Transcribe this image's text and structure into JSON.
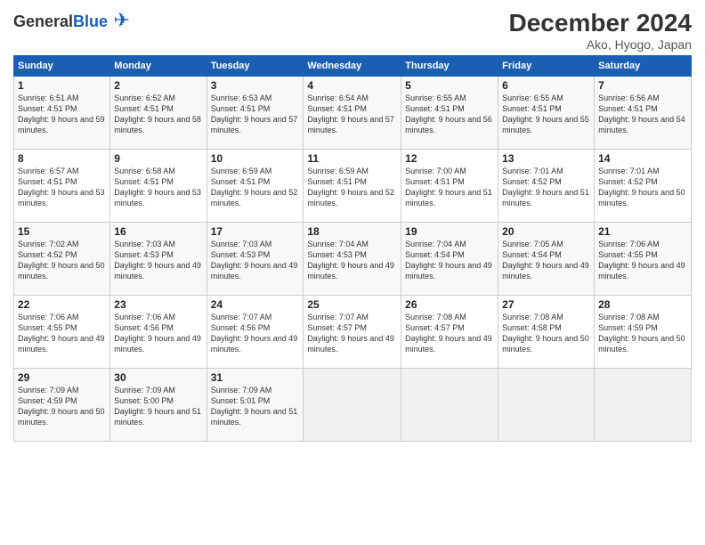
{
  "header": {
    "logo_general": "General",
    "logo_blue": "Blue",
    "month": "December 2024",
    "location": "Ako, Hyogo, Japan"
  },
  "weekdays": [
    "Sunday",
    "Monday",
    "Tuesday",
    "Wednesday",
    "Thursday",
    "Friday",
    "Saturday"
  ],
  "weeks": [
    [
      {
        "day": "1",
        "sunrise": "6:51 AM",
        "sunset": "4:51 PM",
        "daylight": "9 hours and 59 minutes."
      },
      {
        "day": "2",
        "sunrise": "6:52 AM",
        "sunset": "4:51 PM",
        "daylight": "9 hours and 58 minutes."
      },
      {
        "day": "3",
        "sunrise": "6:53 AM",
        "sunset": "4:51 PM",
        "daylight": "9 hours and 57 minutes."
      },
      {
        "day": "4",
        "sunrise": "6:54 AM",
        "sunset": "4:51 PM",
        "daylight": "9 hours and 57 minutes."
      },
      {
        "day": "5",
        "sunrise": "6:55 AM",
        "sunset": "4:51 PM",
        "daylight": "9 hours and 56 minutes."
      },
      {
        "day": "6",
        "sunrise": "6:55 AM",
        "sunset": "4:51 PM",
        "daylight": "9 hours and 55 minutes."
      },
      {
        "day": "7",
        "sunrise": "6:56 AM",
        "sunset": "4:51 PM",
        "daylight": "9 hours and 54 minutes."
      }
    ],
    [
      {
        "day": "8",
        "sunrise": "6:57 AM",
        "sunset": "4:51 PM",
        "daylight": "9 hours and 53 minutes."
      },
      {
        "day": "9",
        "sunrise": "6:58 AM",
        "sunset": "4:51 PM",
        "daylight": "9 hours and 53 minutes."
      },
      {
        "day": "10",
        "sunrise": "6:59 AM",
        "sunset": "4:51 PM",
        "daylight": "9 hours and 52 minutes."
      },
      {
        "day": "11",
        "sunrise": "6:59 AM",
        "sunset": "4:51 PM",
        "daylight": "9 hours and 52 minutes."
      },
      {
        "day": "12",
        "sunrise": "7:00 AM",
        "sunset": "4:51 PM",
        "daylight": "9 hours and 51 minutes."
      },
      {
        "day": "13",
        "sunrise": "7:01 AM",
        "sunset": "4:52 PM",
        "daylight": "9 hours and 51 minutes."
      },
      {
        "day": "14",
        "sunrise": "7:01 AM",
        "sunset": "4:52 PM",
        "daylight": "9 hours and 50 minutes."
      }
    ],
    [
      {
        "day": "15",
        "sunrise": "7:02 AM",
        "sunset": "4:52 PM",
        "daylight": "9 hours and 50 minutes."
      },
      {
        "day": "16",
        "sunrise": "7:03 AM",
        "sunset": "4:53 PM",
        "daylight": "9 hours and 49 minutes."
      },
      {
        "day": "17",
        "sunrise": "7:03 AM",
        "sunset": "4:53 PM",
        "daylight": "9 hours and 49 minutes."
      },
      {
        "day": "18",
        "sunrise": "7:04 AM",
        "sunset": "4:53 PM",
        "daylight": "9 hours and 49 minutes."
      },
      {
        "day": "19",
        "sunrise": "7:04 AM",
        "sunset": "4:54 PM",
        "daylight": "9 hours and 49 minutes."
      },
      {
        "day": "20",
        "sunrise": "7:05 AM",
        "sunset": "4:54 PM",
        "daylight": "9 hours and 49 minutes."
      },
      {
        "day": "21",
        "sunrise": "7:06 AM",
        "sunset": "4:55 PM",
        "daylight": "9 hours and 49 minutes."
      }
    ],
    [
      {
        "day": "22",
        "sunrise": "7:06 AM",
        "sunset": "4:55 PM",
        "daylight": "9 hours and 49 minutes."
      },
      {
        "day": "23",
        "sunrise": "7:06 AM",
        "sunset": "4:56 PM",
        "daylight": "9 hours and 49 minutes."
      },
      {
        "day": "24",
        "sunrise": "7:07 AM",
        "sunset": "4:56 PM",
        "daylight": "9 hours and 49 minutes."
      },
      {
        "day": "25",
        "sunrise": "7:07 AM",
        "sunset": "4:57 PM",
        "daylight": "9 hours and 49 minutes."
      },
      {
        "day": "26",
        "sunrise": "7:08 AM",
        "sunset": "4:57 PM",
        "daylight": "9 hours and 49 minutes."
      },
      {
        "day": "27",
        "sunrise": "7:08 AM",
        "sunset": "4:58 PM",
        "daylight": "9 hours and 50 minutes."
      },
      {
        "day": "28",
        "sunrise": "7:08 AM",
        "sunset": "4:59 PM",
        "daylight": "9 hours and 50 minutes."
      }
    ],
    [
      {
        "day": "29",
        "sunrise": "7:09 AM",
        "sunset": "4:59 PM",
        "daylight": "9 hours and 50 minutes."
      },
      {
        "day": "30",
        "sunrise": "7:09 AM",
        "sunset": "5:00 PM",
        "daylight": "9 hours and 51 minutes."
      },
      {
        "day": "31",
        "sunrise": "7:09 AM",
        "sunset": "5:01 PM",
        "daylight": "9 hours and 51 minutes."
      },
      null,
      null,
      null,
      null
    ]
  ]
}
